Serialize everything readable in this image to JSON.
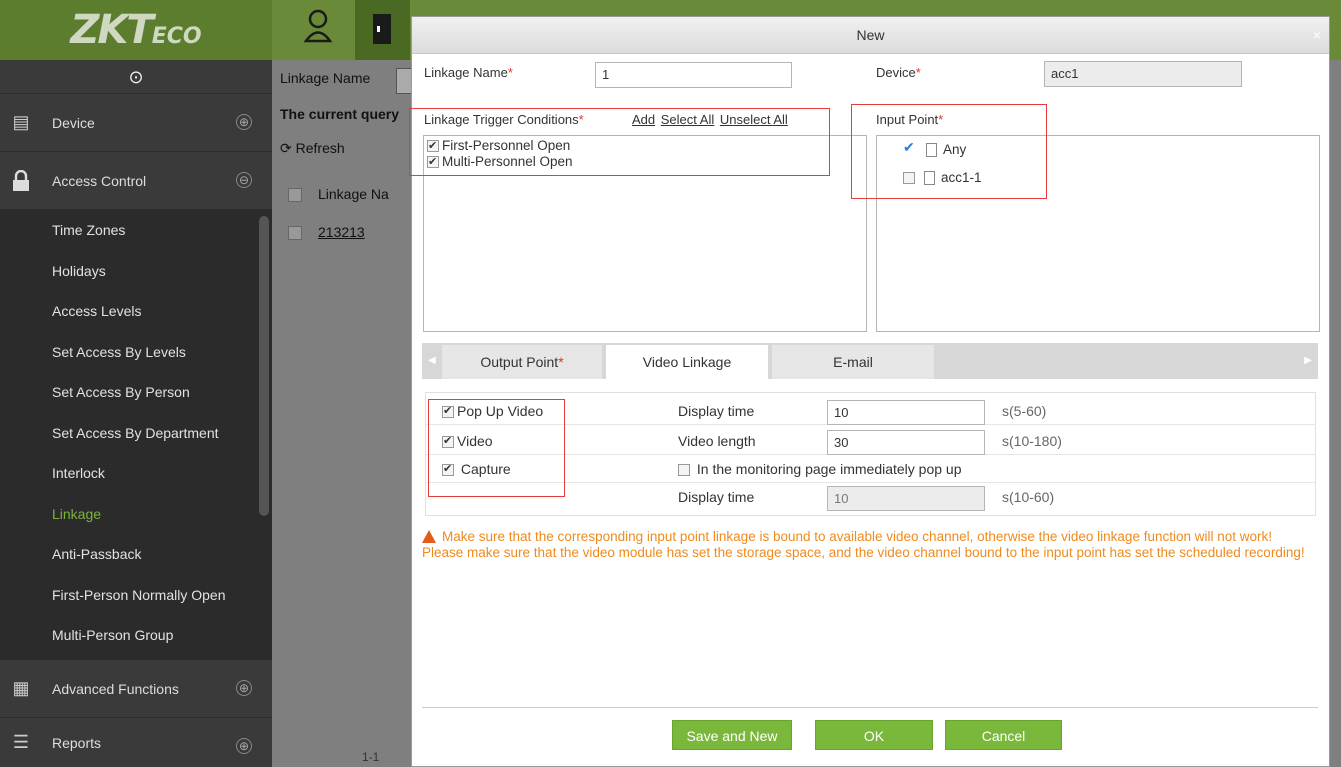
{
  "app": {
    "logo_main": "ZKT",
    "logo_sub": "ECO"
  },
  "sidebar": {
    "groups": [
      {
        "label": "Device",
        "icon": "device-icon",
        "toggle": "⊕"
      },
      {
        "label": "Access Control",
        "icon": "lock-icon",
        "toggle": "⊖"
      },
      {
        "label": "Advanced Functions",
        "icon": "advanced-icon",
        "toggle": "⊕"
      },
      {
        "label": "Reports",
        "icon": "reports-icon",
        "toggle": "⊕"
      }
    ],
    "items": [
      {
        "label": "Time Zones"
      },
      {
        "label": "Holidays"
      },
      {
        "label": "Access Levels"
      },
      {
        "label": "Set Access By Levels"
      },
      {
        "label": "Set Access By Person"
      },
      {
        "label": "Set Access By Department"
      },
      {
        "label": "Interlock"
      },
      {
        "label": "Linkage"
      },
      {
        "label": "Anti-Passback"
      },
      {
        "label": "First-Person Normally Open"
      },
      {
        "label": "Multi-Person Group"
      }
    ],
    "active_item": "Linkage"
  },
  "background": {
    "filter_label": "Linkage Name",
    "query_label": "The current query",
    "refresh_label": "Refresh",
    "column_header": "Linkage Na",
    "row_value": "213213",
    "pagination": "1-1"
  },
  "dialog": {
    "title": "New",
    "close": "×",
    "linkage_name_label": "Linkage Name",
    "linkage_name_value": "1",
    "device_label": "Device",
    "device_value": "acc1",
    "trigger_label": "Linkage Trigger Conditions",
    "trigger_actions": [
      "Add",
      "Select All",
      "Unselect All"
    ],
    "triggers": [
      {
        "label": "First-Personnel Open",
        "checked": true
      },
      {
        "label": "Multi-Personnel Open",
        "checked": true
      }
    ],
    "input_point_label": "Input Point",
    "input_points": [
      {
        "label": "Any",
        "checked": true
      },
      {
        "label": "acc1-1",
        "checked": false
      }
    ],
    "tabs": [
      {
        "label": "Output Point",
        "required": true
      },
      {
        "label": "Video Linkage",
        "required": false
      },
      {
        "label": "E-mail",
        "required": false
      }
    ],
    "active_tab": "Video Linkage",
    "video": {
      "options": [
        {
          "label": "Pop Up Video",
          "checked": true
        },
        {
          "label": "Video",
          "checked": true
        },
        {
          "label": "Capture",
          "checked": true
        }
      ],
      "display_time_label": "Display time",
      "display_time_value": "10",
      "display_time_hint": "s(5-60)",
      "video_length_label": "Video length",
      "video_length_value": "30",
      "video_length_hint": "s(10-180)",
      "monitor_popup_label": "In the monitoring page immediately pop up",
      "capture_display_label": "Display time",
      "capture_display_value": "10",
      "capture_display_hint": "s(10-60)"
    },
    "warning": "Make sure that the corresponding input point linkage is bound to available video channel, otherwise the video linkage function will not work! Please make sure that the video module has set the storage space, and the video channel bound to the input point has set the scheduled recording!",
    "buttons": {
      "save_new": "Save and New",
      "ok": "OK",
      "cancel": "Cancel"
    }
  },
  "colors": {
    "accent": "#7ab83c",
    "required": "#e6332a",
    "warning": "#f08a1c",
    "highlight_box": "#e43d3d"
  }
}
